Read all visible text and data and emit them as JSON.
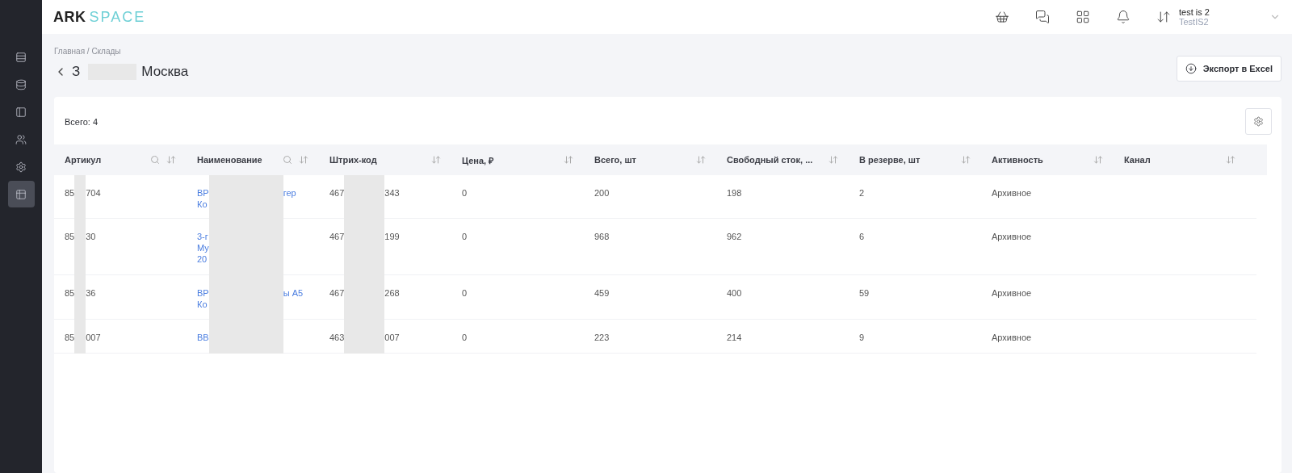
{
  "logo": {
    "first": "ARK",
    "second": "SPACE"
  },
  "sidebar": {
    "items": [
      {
        "selected": false
      },
      {
        "selected": false
      },
      {
        "selected": false
      },
      {
        "selected": false
      },
      {
        "selected": false
      },
      {
        "selected": true
      }
    ]
  },
  "user": {
    "name": "test is 2",
    "org": "TestIS2"
  },
  "breadcrumb": "Главная / Склады",
  "title": {
    "before": "З",
    "after": "Москва"
  },
  "export_button": "Экспорт в Excel",
  "total": "Всего: 4",
  "table": {
    "columns": [
      {
        "label": "Артикул",
        "searchable": true
      },
      {
        "label": "Наименование",
        "searchable": true
      },
      {
        "label": "Штрих-код",
        "searchable": false
      },
      {
        "label": "Цена, ₽",
        "searchable": false
      },
      {
        "label": "Всего, шт",
        "searchable": false
      },
      {
        "label": "Свободный сток, ...",
        "searchable": false
      },
      {
        "label": "В резерве, шт",
        "searchable": false
      },
      {
        "label": "Активность",
        "searchable": false
      },
      {
        "label": "Канал",
        "searchable": false
      }
    ],
    "rows": [
      {
        "article": [
          "85",
          "704"
        ],
        "name": [
          [
            "ВР",
            "гер"
          ],
          [
            "Ко"
          ]
        ],
        "barcode": [
          "467",
          "343"
        ],
        "price": "0",
        "total": "200",
        "free": "198",
        "reserve": "2",
        "activity": "Архивное"
      },
      {
        "article": [
          "85",
          "30"
        ],
        "name": [
          [
            "3-г"
          ],
          [
            "Му"
          ],
          [
            "20"
          ]
        ],
        "barcode": [
          "467",
          "199"
        ],
        "price": "0",
        "total": "968",
        "free": "962",
        "reserve": "6",
        "activity": "Архивное"
      },
      {
        "article": [
          "85",
          "36"
        ],
        "name": [
          [
            "ВР",
            "ы А5"
          ],
          [
            "Ко"
          ]
        ],
        "barcode": [
          "467",
          "268"
        ],
        "price": "0",
        "total": "459",
        "free": "400",
        "reserve": "59",
        "activity": "Архивное"
      },
      {
        "article": [
          "85",
          "007"
        ],
        "name": [
          [
            "ВВ"
          ]
        ],
        "barcode": [
          "463",
          "007"
        ],
        "price": "0",
        "total": "223",
        "free": "214",
        "reserve": "9",
        "activity": "Архивное"
      }
    ]
  }
}
